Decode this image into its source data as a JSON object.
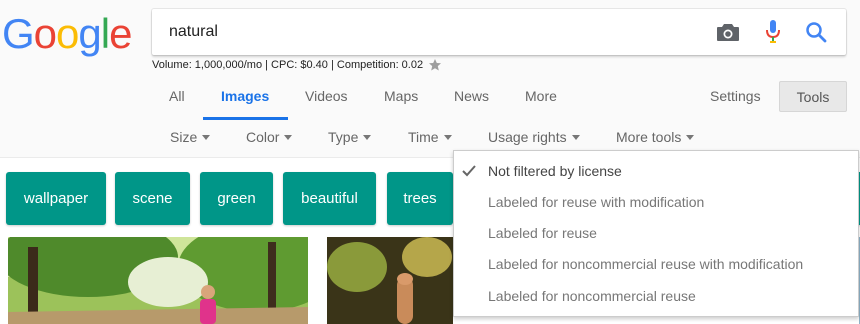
{
  "logo": {
    "letters": [
      "G",
      "o",
      "o",
      "g",
      "l",
      "e"
    ],
    "colors": [
      "#4285F4",
      "#EA4335",
      "#FBBC05",
      "#4285F4",
      "#34A853",
      "#EA4335"
    ]
  },
  "search": {
    "value": "natural"
  },
  "stats": {
    "text": "Volume: 1,000,000/mo | CPC: $0.40 | Competition: 0.02"
  },
  "tabs": [
    {
      "label": "All",
      "active": false
    },
    {
      "label": "Images",
      "active": true
    },
    {
      "label": "Videos",
      "active": false
    },
    {
      "label": "Maps",
      "active": false
    },
    {
      "label": "News",
      "active": false
    },
    {
      "label": "More",
      "active": false
    }
  ],
  "settings_label": "Settings",
  "tools_label": "Tools",
  "filters": [
    "Size",
    "Color",
    "Type",
    "Time",
    "Usage rights",
    "More tools"
  ],
  "chips": [
    "wallpaper",
    "scene",
    "green",
    "beautiful",
    "trees"
  ],
  "chip_color": "#009688",
  "accent": "#1a73e8",
  "usage_rights_menu": [
    {
      "label": "Not filtered by license",
      "selected": true
    },
    {
      "label": "Labeled for reuse with modification",
      "selected": false
    },
    {
      "label": "Labeled for reuse",
      "selected": false
    },
    {
      "label": "Labeled for noncommercial reuse with modification",
      "selected": false
    },
    {
      "label": "Labeled for noncommercial reuse",
      "selected": false
    }
  ]
}
